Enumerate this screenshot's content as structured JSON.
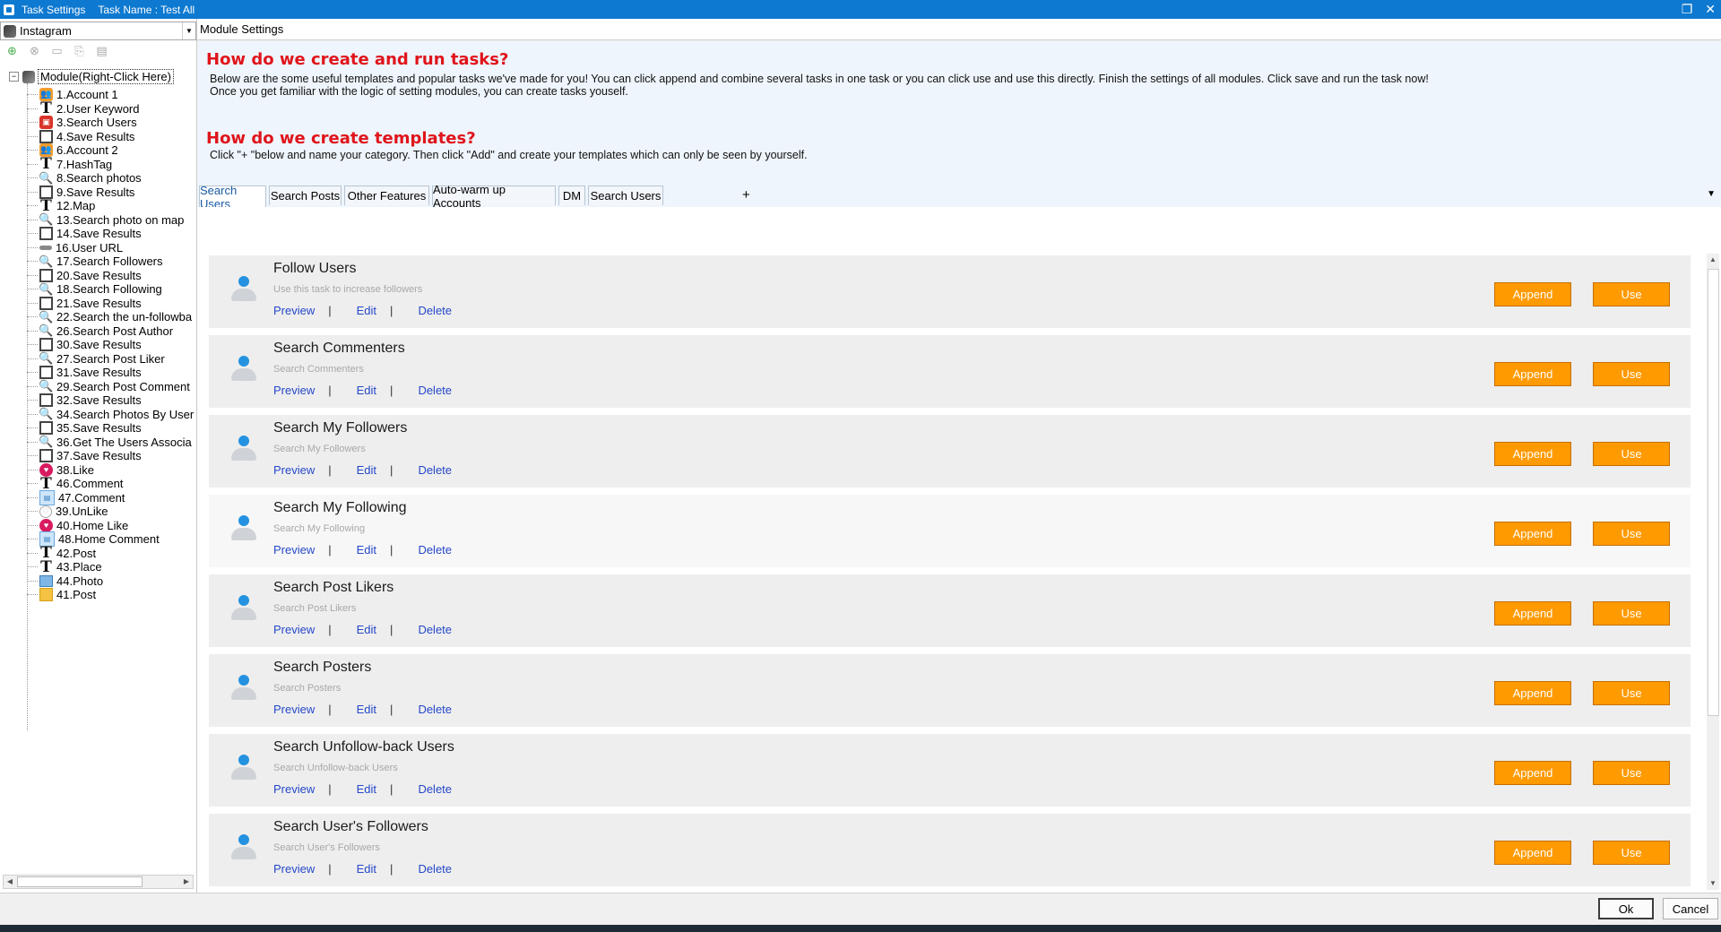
{
  "window": {
    "title": "Task Settings",
    "task_name": "Task Name : Test All",
    "restore_glyph": "❐",
    "close_glyph": "✕"
  },
  "left": {
    "platform": "Instagram",
    "root_label": "Module(Right-Click Here)",
    "items": [
      {
        "label": "1.Account 1",
        "icon": "account-icon"
      },
      {
        "label": "2.User Keyword",
        "icon": "text-icon"
      },
      {
        "label": "3.Search Users",
        "icon": "search-users-icon"
      },
      {
        "label": "4.Save Results",
        "icon": "save-icon"
      },
      {
        "label": "6.Account 2",
        "icon": "account-icon"
      },
      {
        "label": "7.HashTag",
        "icon": "text-icon"
      },
      {
        "label": "8.Search photos",
        "icon": "search-icon"
      },
      {
        "label": "9.Save Results",
        "icon": "save-icon"
      },
      {
        "label": "12.Map",
        "icon": "text-icon"
      },
      {
        "label": "13.Search photo on map",
        "icon": "search-icon"
      },
      {
        "label": "14.Save Results",
        "icon": "save-icon"
      },
      {
        "label": "16.User URL",
        "icon": "url-icon"
      },
      {
        "label": "17.Search Followers",
        "icon": "search-icon"
      },
      {
        "label": "20.Save Results",
        "icon": "save-icon"
      },
      {
        "label": "18.Search Following",
        "icon": "search-icon"
      },
      {
        "label": "21.Save Results",
        "icon": "save-icon"
      },
      {
        "label": "22.Search the un-followba",
        "icon": "search-icon"
      },
      {
        "label": "26.Search Post Author",
        "icon": "search-icon"
      },
      {
        "label": "30.Save Results",
        "icon": "save-icon"
      },
      {
        "label": "27.Search Post Liker",
        "icon": "search-icon"
      },
      {
        "label": "31.Save Results",
        "icon": "save-icon"
      },
      {
        "label": "29.Search Post Comment",
        "icon": "search-icon"
      },
      {
        "label": "32.Save Results",
        "icon": "save-icon"
      },
      {
        "label": "34.Search Photos By User",
        "icon": "search-icon"
      },
      {
        "label": "35.Save Results",
        "icon": "save-icon"
      },
      {
        "label": "36.Get The Users Associa",
        "icon": "search-icon"
      },
      {
        "label": "37.Save Results",
        "icon": "save-icon"
      },
      {
        "label": "38.Like",
        "icon": "like-icon"
      },
      {
        "label": "46.Comment",
        "icon": "text-icon"
      },
      {
        "label": "47.Comment",
        "icon": "comment-icon"
      },
      {
        "label": "39.UnLike",
        "icon": "unlike-icon"
      },
      {
        "label": "40.Home Like",
        "icon": "like-icon"
      },
      {
        "label": "48.Home Comment",
        "icon": "comment-icon"
      },
      {
        "label": "42.Post",
        "icon": "text-icon"
      },
      {
        "label": "43.Place",
        "icon": "text-icon"
      },
      {
        "label": "44.Photo",
        "icon": "photo-icon"
      },
      {
        "label": "41.Post",
        "icon": "post-icon"
      }
    ]
  },
  "module": {
    "header": "Module Settings",
    "how_run_title": "How do we create and run tasks?",
    "how_run_text": "Below are the some useful templates and popular tasks we've made for you!  You can click append and combine several tasks in one task or you can click use and use this directly. Finish the settings of all modules. Click save and run the task now!\nOnce you get familiar with the logic of setting modules, you can create tasks youself.",
    "how_tpl_title": "How do we create templates?",
    "how_tpl_text": "Click \"+ \"below and name your category. Then click \"Add\" and create your templates which can only be seen by yourself.",
    "tabs": [
      "Search Users",
      "Search Posts",
      "Other Features",
      "Auto-warm up Accounts",
      "DM",
      "Search Users"
    ],
    "tab_add": "+",
    "active_tab": 0
  },
  "cards": [
    {
      "title": "Follow Users",
      "desc": "Use this task to increase followers"
    },
    {
      "title": "Search Commenters",
      "desc": "Search Commenters"
    },
    {
      "title": "Search My Followers",
      "desc": "Search My Followers"
    },
    {
      "title": "Search My Following",
      "desc": "Search My Following"
    },
    {
      "title": "Search Post Likers",
      "desc": "Search Post Likers"
    },
    {
      "title": "Search Posters",
      "desc": "Search Posters"
    },
    {
      "title": "Search Unfollow-back Users",
      "desc": "Search Unfollow-back Users"
    },
    {
      "title": "Search User's Followers",
      "desc": "Search User's Followers"
    }
  ],
  "card_actions": {
    "preview": "Preview",
    "edit": "Edit",
    "delete": "Delete",
    "separator": "|",
    "append": "Append",
    "use": "Use"
  },
  "footer": {
    "ok": "Ok",
    "cancel": "Cancel"
  },
  "colors": {
    "titlebar": "#0d79d0",
    "accent_button": "#ff9a00",
    "heading_red": "#e0141b",
    "link_blue": "#2548c9"
  }
}
